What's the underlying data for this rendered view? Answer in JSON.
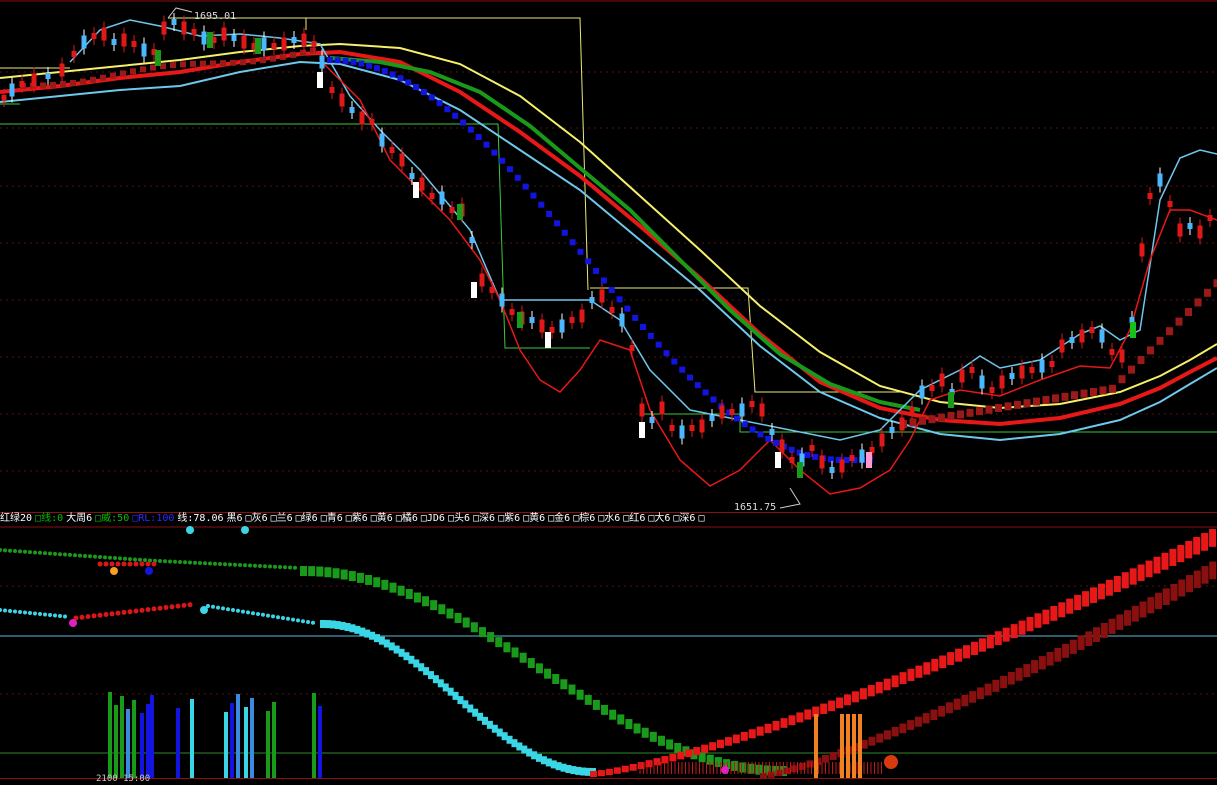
{
  "annotations": {
    "high_price": "1695.01",
    "low_price": "1651.75"
  },
  "legend": [
    {
      "text": "红绿20",
      "color": "#ffffff"
    },
    {
      "text": "□线:0",
      "color": "#00c000"
    },
    {
      "text": "大周6",
      "color": "#ffffff"
    },
    {
      "text": "□威:50",
      "color": "#00c000"
    },
    {
      "text": "□RL:100",
      "color": "#2a2aff"
    },
    {
      "text": "线:78.06",
      "color": "#ffffff"
    },
    {
      "text": "黑6",
      "color": "#ffffff"
    },
    {
      "text": "□灰6",
      "color": "#ffffff"
    },
    {
      "text": "□兰6",
      "color": "#ffffff"
    },
    {
      "text": "□绿6",
      "color": "#ffffff"
    },
    {
      "text": "□青6",
      "color": "#ffffff"
    },
    {
      "text": "□紫6",
      "color": "#ffffff"
    },
    {
      "text": "□黄6",
      "color": "#ffffff"
    },
    {
      "text": "□橘6",
      "color": "#ffffff"
    },
    {
      "text": "□JD6",
      "color": "#ffffff"
    },
    {
      "text": "□头6",
      "color": "#ffffff"
    },
    {
      "text": "□深6",
      "color": "#ffffff"
    },
    {
      "text": "□紫6",
      "color": "#ffffff"
    },
    {
      "text": "□黄6",
      "color": "#ffffff"
    },
    {
      "text": "□金6",
      "color": "#ffffff"
    },
    {
      "text": "□棕6",
      "color": "#ffffff"
    },
    {
      "text": "□水6",
      "color": "#ffffff"
    },
    {
      "text": "□红6",
      "color": "#ffffff"
    },
    {
      "text": "□大6",
      "color": "#ffffff"
    },
    {
      "text": "□深6",
      "color": "#ffffff"
    },
    {
      "text": "□",
      "color": "#ffffff"
    }
  ],
  "axis": {
    "time_label": "2100 15:00"
  },
  "colors": {
    "background": "#000000",
    "candle_up": "#e01818",
    "candle_down": "#4ab8ff",
    "ma_red": "#e81818",
    "ma_green": "#1a9a1a",
    "ma_yellow": "#f5f06a",
    "ma_cyan": "#6ec8ec",
    "blue_dots": "#1414e0",
    "maroon_bars": "#9a1a1a",
    "frame": "#8a1010"
  }
}
